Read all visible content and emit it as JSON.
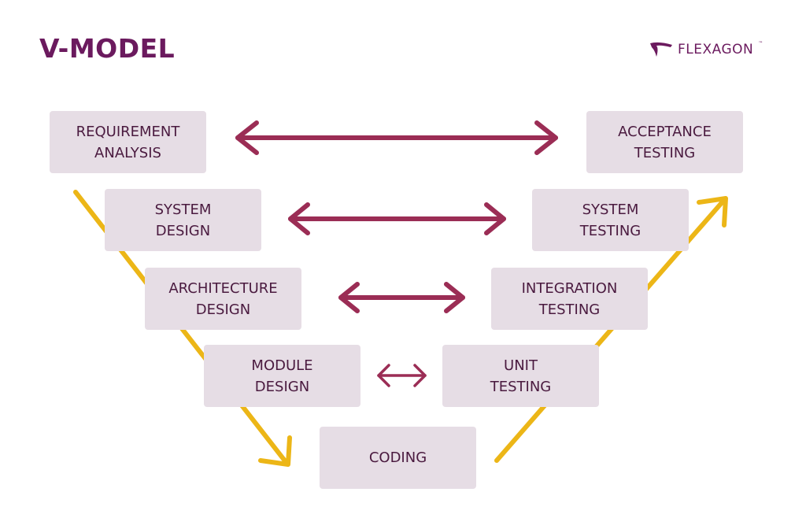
{
  "title": "V-MODEL",
  "logo": {
    "text": "FLEXAGON",
    "tm": "™"
  },
  "colors": {
    "box": "#e6dde5",
    "text": "#4a1a3f",
    "arrow_pair": "#9b2d55",
    "arrow_flow": "#ecb617",
    "title": "#6b1a5e"
  },
  "left_phases": [
    "REQUIREMENT\nANALYSIS",
    "SYSTEM\nDESIGN",
    "ARCHITECTURE\nDESIGN",
    "MODULE\nDESIGN"
  ],
  "bottom_phase": "CODING",
  "right_phases": [
    "ACCEPTANCE\nTESTING",
    "SYSTEM\nTESTING",
    "INTEGRATION\nTESTING",
    "UNIT\nTESTING"
  ]
}
